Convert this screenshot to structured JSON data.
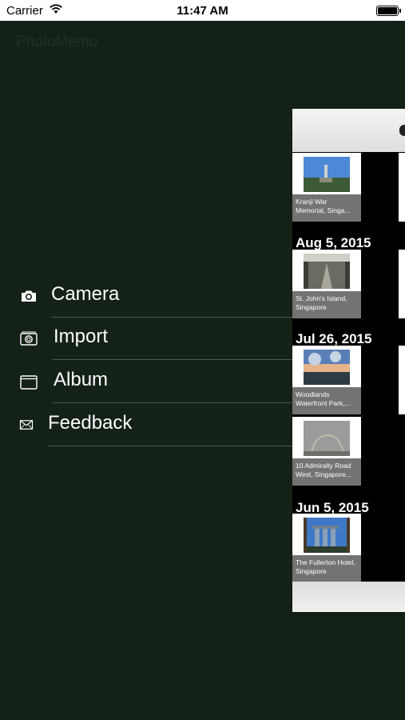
{
  "status_bar": {
    "carrier": "Carrier",
    "time": "11:47 AM"
  },
  "app": {
    "title": "PhotoMemo"
  },
  "menu": [
    {
      "name": "camera",
      "label": "Camera",
      "icon": "camera-icon"
    },
    {
      "name": "import",
      "label": "Import",
      "icon": "import-photos-icon"
    },
    {
      "name": "album",
      "label": "Album",
      "icon": "album-icon"
    },
    {
      "name": "feedback",
      "label": "Feedback",
      "icon": "envelope-icon"
    }
  ],
  "timeline": {
    "groups": [
      {
        "date": "",
        "photos": [
          {
            "caption": "Kranji War Memorial, Singa..."
          }
        ]
      },
      {
        "date": "Aug 5, 2015",
        "photos": [
          {
            "caption": "St. John's Island, Singapore"
          }
        ]
      },
      {
        "date": "Jul 26, 2015",
        "photos": [
          {
            "caption": "Woodlands Waterfront Park,..."
          },
          {
            "caption": "10 Admiralty Road West, Singapore..."
          }
        ]
      },
      {
        "date": "Jun 5, 2015",
        "photos": [
          {
            "caption": "The Fullerton Hotel, Singapore"
          }
        ]
      }
    ]
  },
  "colors": {
    "background": "#142117",
    "menu_text": "#ffffff",
    "divider": "#4a5a4d",
    "panel": "#000000"
  }
}
